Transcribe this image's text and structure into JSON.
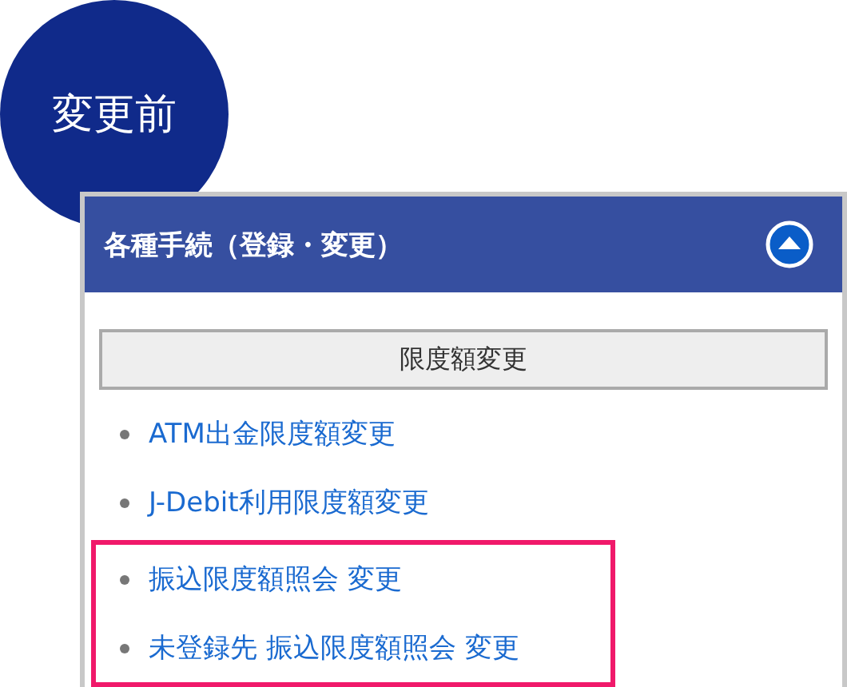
{
  "badge": {
    "label": "変更前"
  },
  "panel": {
    "title": "各種手続（登録・変更）",
    "expanded": true,
    "button": "限度額変更",
    "items": [
      {
        "label": "ATM出金限度額変更",
        "highlighted": false
      },
      {
        "label": "J-Debit利用限度額変更",
        "highlighted": false
      },
      {
        "label": "振込限度額照会 変更",
        "highlighted": true
      },
      {
        "label": "未登録先 振込限度額照会 変更",
        "highlighted": true
      }
    ]
  }
}
